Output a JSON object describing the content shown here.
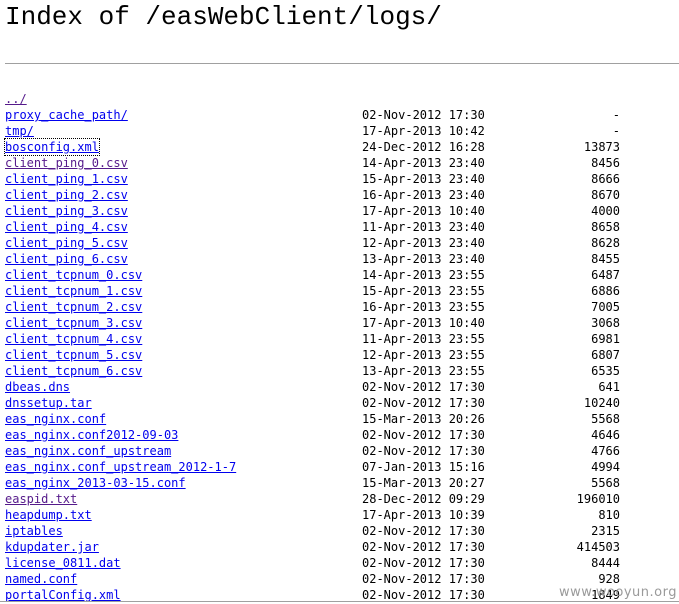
{
  "page": {
    "title": "Index of /easWebClient/logs/"
  },
  "listing": {
    "parent_link": "../",
    "entries": [
      {
        "name": "proxy_cache_path/",
        "date": "02-Nov-2012 17:30",
        "size": "-"
      },
      {
        "name": "tmp/",
        "date": "17-Apr-2013 10:42",
        "size": "-"
      },
      {
        "name": "bosconfig.xml",
        "date": "24-Dec-2012 16:28",
        "size": "13873"
      },
      {
        "name": "client_ping_0.csv",
        "date": "14-Apr-2013 23:40",
        "size": "8456"
      },
      {
        "name": "client_ping_1.csv",
        "date": "15-Apr-2013 23:40",
        "size": "8666"
      },
      {
        "name": "client_ping_2.csv",
        "date": "16-Apr-2013 23:40",
        "size": "8670"
      },
      {
        "name": "client_ping_3.csv",
        "date": "17-Apr-2013 10:40",
        "size": "4000"
      },
      {
        "name": "client_ping_4.csv",
        "date": "11-Apr-2013 23:40",
        "size": "8658"
      },
      {
        "name": "client_ping_5.csv",
        "date": "12-Apr-2013 23:40",
        "size": "8628"
      },
      {
        "name": "client_ping_6.csv",
        "date": "13-Apr-2013 23:40",
        "size": "8455"
      },
      {
        "name": "client_tcpnum_0.csv",
        "date": "14-Apr-2013 23:55",
        "size": "6487"
      },
      {
        "name": "client_tcpnum_1.csv",
        "date": "15-Apr-2013 23:55",
        "size": "6886"
      },
      {
        "name": "client_tcpnum_2.csv",
        "date": "16-Apr-2013 23:55",
        "size": "7005"
      },
      {
        "name": "client_tcpnum_3.csv",
        "date": "17-Apr-2013 10:40",
        "size": "3068"
      },
      {
        "name": "client_tcpnum_4.csv",
        "date": "11-Apr-2013 23:55",
        "size": "6981"
      },
      {
        "name": "client_tcpnum_5.csv",
        "date": "12-Apr-2013 23:55",
        "size": "6807"
      },
      {
        "name": "client_tcpnum_6.csv",
        "date": "13-Apr-2013 23:55",
        "size": "6535"
      },
      {
        "name": "dbeas.dns",
        "date": "02-Nov-2012 17:30",
        "size": "641"
      },
      {
        "name": "dnssetup.tar",
        "date": "02-Nov-2012 17:30",
        "size": "10240"
      },
      {
        "name": "eas_nginx.conf",
        "date": "15-Mar-2013 20:26",
        "size": "5568"
      },
      {
        "name": "eas_nginx.conf2012-09-03",
        "date": "02-Nov-2012 17:30",
        "size": "4646"
      },
      {
        "name": "eas_nginx.conf_upstream",
        "date": "02-Nov-2012 17:30",
        "size": "4766"
      },
      {
        "name": "eas_nginx.conf_upstream_2012-1-7",
        "date": "07-Jan-2013 15:16",
        "size": "4994"
      },
      {
        "name": "eas_nginx_2013-03-15.conf",
        "date": "15-Mar-2013 20:27",
        "size": "5568"
      },
      {
        "name": "easpid.txt",
        "date": "28-Dec-2012 09:29",
        "size": "196010"
      },
      {
        "name": "heapdump.txt",
        "date": "17-Apr-2013 10:39",
        "size": "810"
      },
      {
        "name": "iptables",
        "date": "02-Nov-2012 17:30",
        "size": "2315"
      },
      {
        "name": "kdupdater.jar",
        "date": "02-Nov-2012 17:30",
        "size": "414503"
      },
      {
        "name": "license_0811.dat",
        "date": "02-Nov-2012 17:30",
        "size": "8444"
      },
      {
        "name": "named.conf",
        "date": "02-Nov-2012 17:30",
        "size": "928"
      },
      {
        "name": "portalConfig.xml",
        "date": "02-Nov-2012 17:30",
        "size": "1849"
      }
    ]
  },
  "watermark": {
    "text": "www.wooyun.org"
  },
  "colors": {
    "link": "#0000ee",
    "visited_link": "#551a8b",
    "rule": "#a0a0a0",
    "watermark": "#9a9a9a"
  }
}
